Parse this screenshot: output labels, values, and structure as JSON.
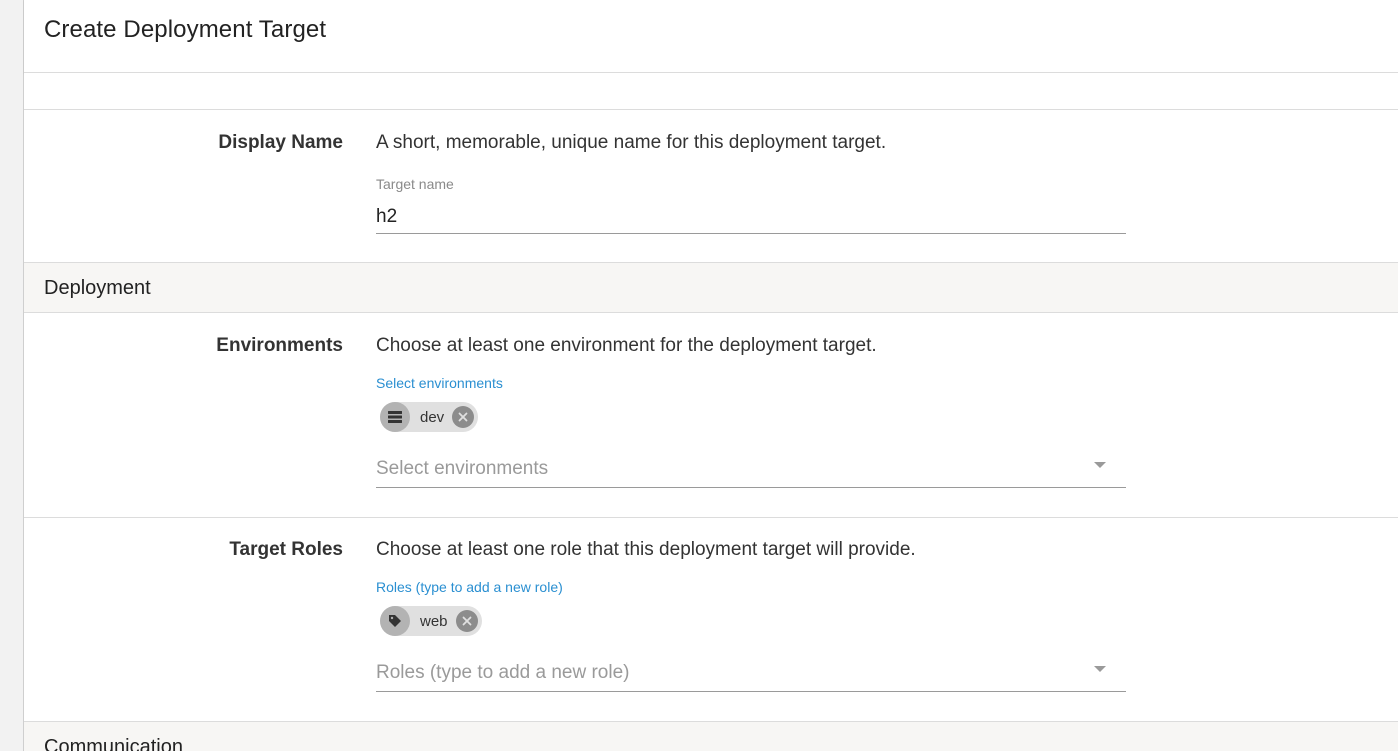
{
  "page": {
    "title": "Create Deployment Target"
  },
  "display_name": {
    "label": "Display Name",
    "description": "A short, memorable, unique name for this deployment target.",
    "field_caption": "Target name",
    "field_value": "h2"
  },
  "deployment_section": {
    "title": "Deployment"
  },
  "environments": {
    "label": "Environments",
    "description": "Choose at least one environment for the deployment target.",
    "field_caption": "Select environments",
    "chips": [
      {
        "label": "dev",
        "icon": "environment-list-icon"
      }
    ],
    "placeholder": "Select environments"
  },
  "target_roles": {
    "label": "Target Roles",
    "description": "Choose at least one role that this deployment target will provide.",
    "field_caption": "Roles (type to add a new role)",
    "chips": [
      {
        "label": "web",
        "icon": "tag-icon"
      }
    ],
    "placeholder": "Roles (type to add a new role)"
  },
  "communication_section": {
    "title": "Communication"
  },
  "colors": {
    "accent_blue": "#2a8fd1",
    "section_bg": "#f7f6f4",
    "chip_bg": "#e0e0e0"
  }
}
